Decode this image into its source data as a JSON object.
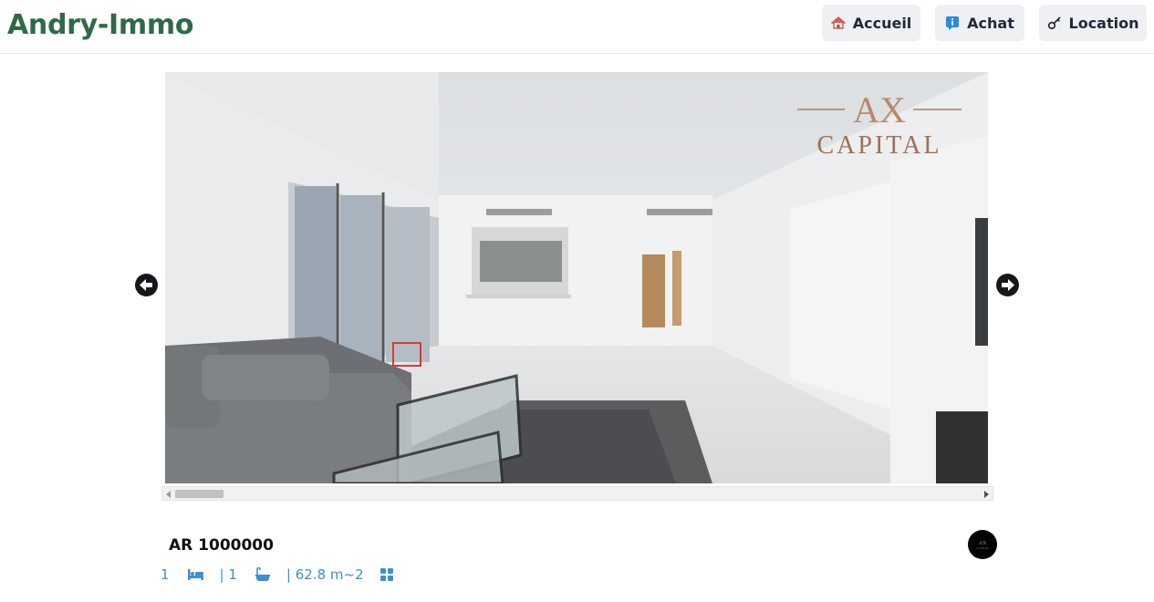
{
  "header": {
    "brand": "Andry-Immo",
    "nav": [
      {
        "label": "Accueil",
        "icon": "house-icon"
      },
      {
        "label": "Achat",
        "icon": "info-icon"
      },
      {
        "label": "Location",
        "icon": "key-icon"
      }
    ]
  },
  "carousel": {
    "watermark": {
      "monogram": "AX",
      "text": "CAPITAL"
    },
    "prev_label": "previous",
    "next_label": "next"
  },
  "listing": {
    "price": "AR 1000000",
    "bedrooms": "1",
    "bathrooms": "| 1",
    "area": "| 62.8 m~2"
  },
  "colors": {
    "brand": "#2f6a47",
    "nav_bg": "#eef0f4",
    "feature_blue": "#3b8fd4"
  }
}
